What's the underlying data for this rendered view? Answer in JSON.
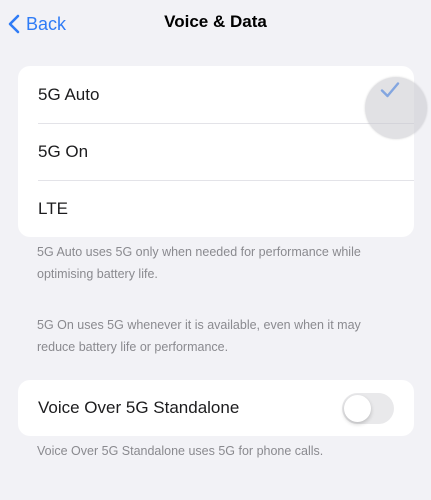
{
  "nav": {
    "back_label": "Back",
    "title": "Voice & Data"
  },
  "modes": {
    "items": [
      {
        "label": "5G Auto",
        "selected": true
      },
      {
        "label": "5G On",
        "selected": false
      },
      {
        "label": "LTE",
        "selected": false
      }
    ],
    "footnote_1": "5G Auto uses 5G only when needed for performance while optimising battery life.",
    "footnote_2": "5G On uses 5G whenever it is available, even when it may reduce battery life or performance."
  },
  "voice": {
    "label": "Voice Over 5G Standalone",
    "enabled": false,
    "footnote": "Voice Over 5G Standalone uses 5G for phone calls."
  },
  "colors": {
    "accent": "#2f7cf6",
    "background": "#f2f2f6",
    "toggle_off": "#e9e9eb"
  },
  "icons": {
    "back": "chevron-left-icon",
    "selected": "checkmark-icon"
  }
}
